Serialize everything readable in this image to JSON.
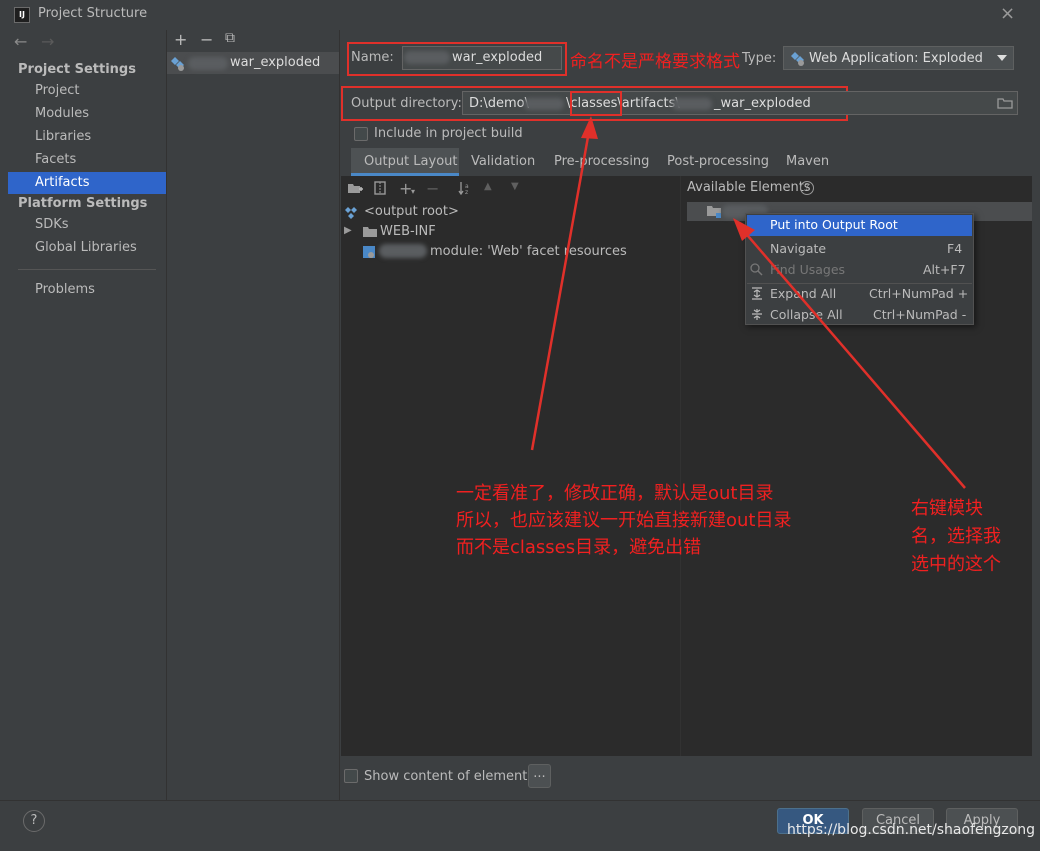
{
  "window": {
    "title": "Project Structure",
    "app_icon_text": "IJ",
    "close_glyph": "×"
  },
  "nav": {
    "back_glyph": "←",
    "forward_glyph": "→",
    "project_settings_header": "Project Settings",
    "project_settings_items": [
      "Project",
      "Modules",
      "Libraries",
      "Facets",
      "Artifacts"
    ],
    "platform_settings_header": "Platform Settings",
    "platform_settings_items": [
      "SDKs",
      "Global Libraries"
    ],
    "problems": "Problems",
    "selected": "Artifacts"
  },
  "artifacts": {
    "toolbar": {
      "add": "+",
      "remove": "−",
      "copy": "⧉"
    },
    "items": [
      {
        "label": "war_exploded"
      }
    ]
  },
  "config": {
    "name_label": "Name:",
    "name_value": "war_exploded",
    "type_label": "Type:",
    "type_value": "Web Application: Exploded",
    "output_dir_label": "Output directory:",
    "output_dir_part1": "D:\\demo\\",
    "output_dir_part2": "\\classes\\artifacts\\",
    "output_dir_part3": "_war_exploded",
    "include_build_label": "Include in project build",
    "include_build_checked": false
  },
  "tabs": [
    {
      "label": "Output Layout",
      "active": true
    },
    {
      "label": "Validation"
    },
    {
      "label": "Pre-processing"
    },
    {
      "label": "Post-processing"
    },
    {
      "label": "Maven"
    }
  ],
  "layout": {
    "tree": [
      {
        "label": "<output root>"
      },
      {
        "label": "WEB-INF"
      },
      {
        "label": "module: 'Web' facet resources"
      }
    ],
    "available_elements_label": "Available Elements",
    "help_glyph": "?"
  },
  "context_menu": {
    "items": [
      {
        "label": "Put into Output Root",
        "shortcut": "",
        "selected": true
      },
      {
        "label": "Navigate",
        "shortcut": "F4"
      },
      {
        "label": "Find Usages",
        "shortcut": "Alt+F7",
        "disabled": true
      },
      {
        "label": "Expand All",
        "shortcut": "Ctrl+NumPad +"
      },
      {
        "label": "Collapse All",
        "shortcut": "Ctrl+NumPad -"
      }
    ]
  },
  "show_content_label": "Show content of elements",
  "more_button": "...",
  "buttons": {
    "ok": "OK",
    "cancel": "Cancel",
    "apply": "Apply",
    "help": "?"
  },
  "annotations": {
    "name_note": "命名不是严格要求格式",
    "output_note_line1": "一定看准了，修改正确，默认是out目录",
    "output_note_line2": "所以，也应该建议一开始直接新建out目录",
    "output_note_line3": "而不是classes目录，避免出错",
    "right_note_line1": "右键模块",
    "right_note_line2": "名，选择我",
    "right_note_line3": "选中的这个"
  },
  "watermark": "https://blog.csdn.net/shaofengzong",
  "colors": {
    "accent": "#2f65ca",
    "annotation_red": "#e0302a",
    "background": "#3c3f41"
  }
}
